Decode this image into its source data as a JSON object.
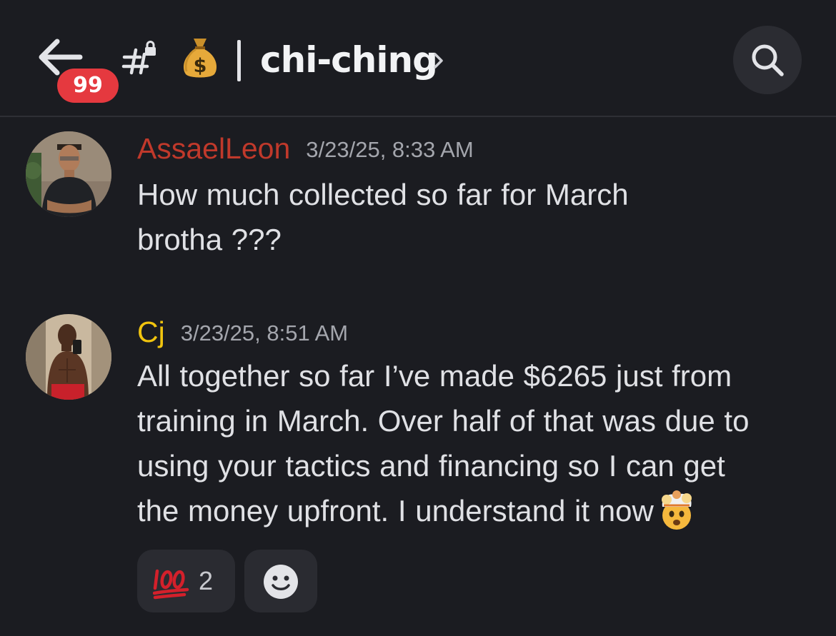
{
  "header": {
    "back_icon": "arrow-left-icon",
    "unread_count": "99",
    "channel_icon": "locked-channel-hash-icon",
    "channel_emoji": "money-bag-emoji",
    "channel_name": "chi-ching",
    "chevron_icon": "chevron-right-icon",
    "search_icon": "search-icon"
  },
  "messages": [
    {
      "author": "AssaelLeon",
      "author_color": "#c0392b",
      "timestamp": "3/23/25, 8:33 AM",
      "lines": [
        "How much collected so far for March",
        "brotha ???"
      ]
    },
    {
      "author": "Cj",
      "author_color": "#f1c40f",
      "timestamp": "3/23/25, 8:51 AM",
      "lines": [
        "All together so far I’ve made $6265 just from",
        "training in March. Over half of that was due to",
        "using your tactics and financing so I can get",
        "the money upfront. I understand it now"
      ],
      "trailing_emoji": "exploding-head-emoji"
    }
  ],
  "reactions": [
    {
      "emoji": "hundred-points-emoji",
      "count": "2"
    },
    {
      "emoji": "add-reaction-icon"
    }
  ],
  "colors": {
    "background": "#1b1c21",
    "badge": "#e5393f",
    "reaction_bg": "#2a2b31"
  }
}
